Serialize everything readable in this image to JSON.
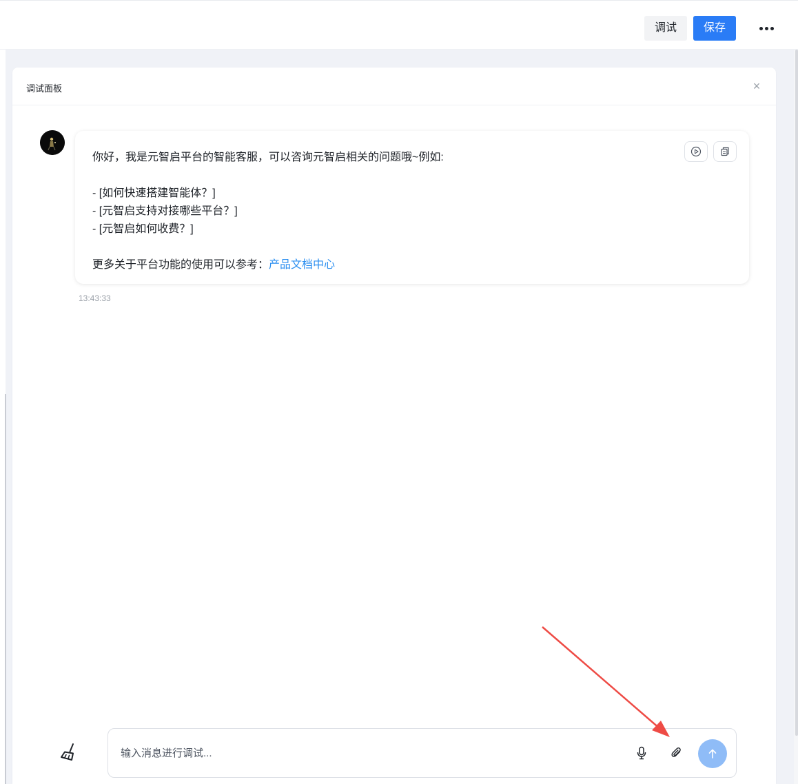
{
  "topbar": {
    "debug_label": "调试",
    "save_label": "保存"
  },
  "panel": {
    "title": "调试面板",
    "close_glyph": "×"
  },
  "message": {
    "greeting": "你好，我是元智启平台的智能客服，可以咨询元智启相关的问题哦~例如:",
    "examples": [
      "- [如何快速搭建智能体？]",
      "- [元智启支持对接哪些平台？]",
      "- [元智启如何收费？]"
    ],
    "more_prefix": "更多关于平台功能的使用可以参考：",
    "more_link": "产品文档中心",
    "timestamp": "13:43:33"
  },
  "input": {
    "placeholder": "输入消息进行调试..."
  },
  "colors": {
    "primary": "#2a7cf6",
    "link": "#2a8ef0",
    "send_disabled": "#8fbcf7",
    "annotation_arrow": "#ee4b45"
  },
  "icons": [
    "more-icon",
    "close-icon",
    "avatar",
    "play-icon",
    "copy-icon",
    "broom-icon",
    "microphone-icon",
    "paperclip-icon",
    "send-arrow-icon"
  ]
}
